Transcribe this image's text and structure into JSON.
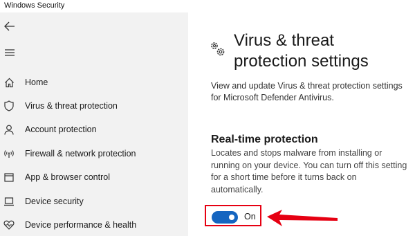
{
  "window": {
    "title": "Windows Security"
  },
  "sidebar": {
    "back_icon": "back-arrow-icon",
    "menu_icon": "hamburger-icon",
    "items": [
      {
        "label": "Home",
        "icon": "home-icon"
      },
      {
        "label": "Virus & threat protection",
        "icon": "shield-icon"
      },
      {
        "label": "Account protection",
        "icon": "person-icon"
      },
      {
        "label": "Firewall & network protection",
        "icon": "wifi-antenna-icon"
      },
      {
        "label": "App & browser control",
        "icon": "app-window-icon"
      },
      {
        "label": "Device security",
        "icon": "laptop-icon"
      },
      {
        "label": "Device performance & health",
        "icon": "heart-icon"
      }
    ]
  },
  "main": {
    "title": "Virus & threat protection settings",
    "title_icon": "gears-icon",
    "description": "View and update Virus & threat protection settings for Microsoft Defender Antivirus.",
    "realtime": {
      "heading": "Real-time protection",
      "description": "Locates and stops malware from installing or running on your device. You can turn off this setting for a short time before it turns back on automatically.",
      "toggle_state": "On",
      "toggle_on": true
    }
  },
  "colors": {
    "sidebar_bg": "#f2f2f2",
    "toggle_on": "#1565c0",
    "highlight": "#e60012"
  }
}
